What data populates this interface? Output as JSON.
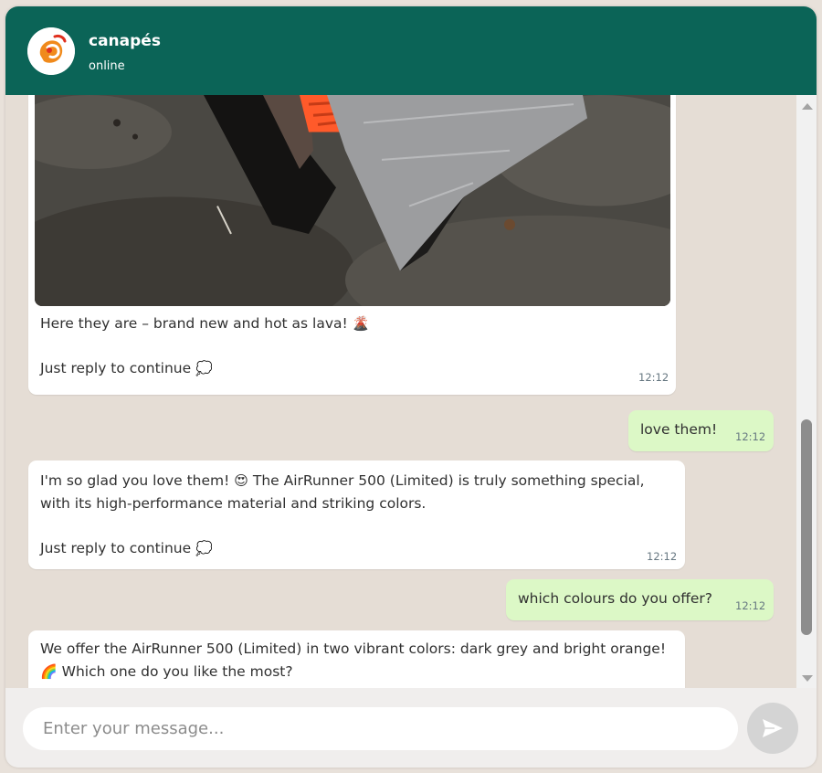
{
  "header": {
    "title": "canapés",
    "status": "online"
  },
  "messages": [
    {
      "direction": "in",
      "has_image": true,
      "line1": "Here they are – brand new and hot as lava!",
      "line1_emoji": "🌋",
      "line2": "Just reply to continue",
      "line2_emoji": "💭",
      "time": "12:12"
    },
    {
      "direction": "out",
      "text": "love them!",
      "time": "12:12"
    },
    {
      "direction": "in",
      "line1a": "I'm so glad you love them!",
      "line1_emoji": "😍",
      "line1b": "The AirRunner 500 (Limited) is truly something special,",
      "line2": "with its high-performance material and striking colors.",
      "line3": "Just reply to continue",
      "line3_emoji": "💭",
      "time": "12:12"
    },
    {
      "direction": "out",
      "text": "which colours do you offer?",
      "time": "12:12"
    },
    {
      "direction": "in",
      "line1": "We offer the AirRunner 500 (Limited) in two vibrant colors: dark grey and bright orange!",
      "line2_emoji": "🌈",
      "line2": "Which one do you like the most?"
    }
  ],
  "composer": {
    "placeholder": "Enter your message...",
    "send_icon": "send-icon"
  },
  "colors": {
    "header": "#0b6457",
    "outgoing_bubble": "#dcf8c6",
    "incoming_bubble": "#ffffff",
    "chat_bg": "#e5ddd5"
  }
}
